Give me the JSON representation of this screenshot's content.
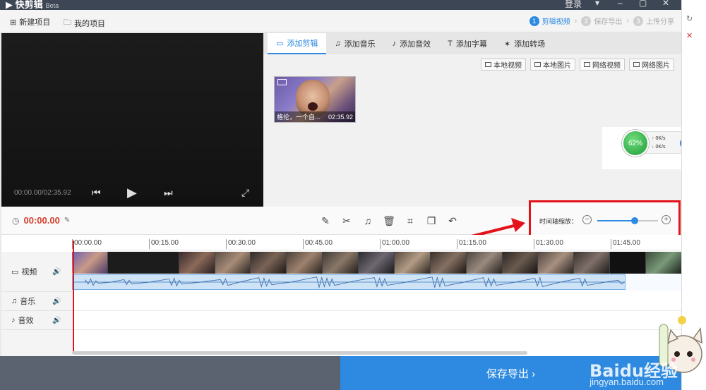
{
  "app": {
    "name": "快剪辑",
    "badge": "Beta"
  },
  "titlebar": {
    "login": "登录"
  },
  "menubar": {
    "new_project": "新建项目",
    "my_projects": "我的项目"
  },
  "steps": [
    {
      "num": "1",
      "label": "剪辑视频",
      "active": true
    },
    {
      "num": "2",
      "label": "保存导出",
      "active": false
    },
    {
      "num": "3",
      "label": "上传分享",
      "active": false
    }
  ],
  "preview": {
    "time": "00:00.00/02:35.92"
  },
  "tabs": [
    "添加剪辑",
    "添加音乐",
    "添加音效",
    "添加字幕",
    "添加转场"
  ],
  "source_buttons": [
    "本地视频",
    "本地图片",
    "网络视频",
    "网络图片"
  ],
  "clip": {
    "title": "格伦，一个自...",
    "duration": "02:35.92"
  },
  "net_widget": {
    "percent": "62%",
    "up": "0K/s",
    "down": "0K/s"
  },
  "toolbar": {
    "current_time": "00:00.00"
  },
  "zoom": {
    "label": "时间轴缩放：",
    "level": 0.62
  },
  "ruler": [
    "00:00.00",
    "00:15.00",
    "00:30.00",
    "00:45.00",
    "01:00.00",
    "01:15.00",
    "01:30.00",
    "01:45.00"
  ],
  "tracks": {
    "video": "视频",
    "music": "音乐",
    "sfx": "音效"
  },
  "footer": {
    "export_label": "保存导出 ›"
  },
  "watermark": {
    "logo": "Baidu经验",
    "url": "jingyan.baidu.com"
  },
  "accent": "#2d8ae0",
  "highlight": "#e4121b"
}
